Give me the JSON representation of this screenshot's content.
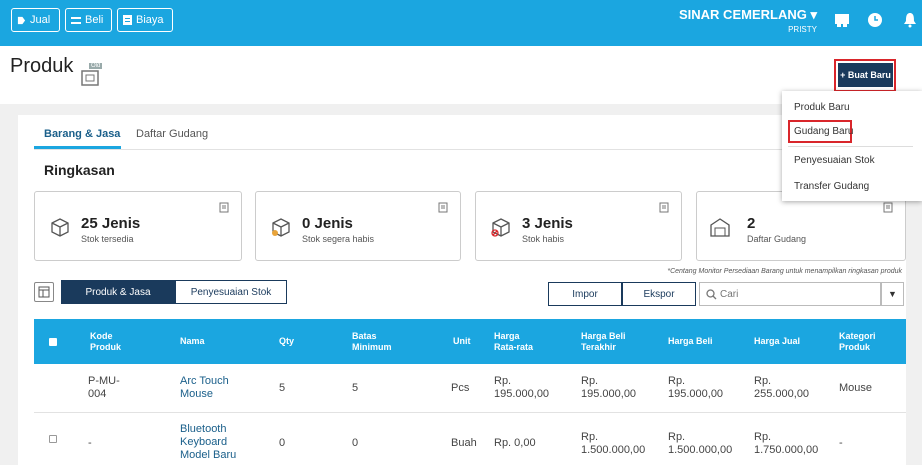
{
  "topbar": {
    "jual": "Jual",
    "beli": "Beli",
    "biaya": "Biaya",
    "company": "SINAR CEMERLANG",
    "user": "PRISTY"
  },
  "page": {
    "title": "Produk",
    "old_badge": "Old",
    "create_button": "+ Buat Baru"
  },
  "dropdown": {
    "items": [
      "Produk Baru",
      "Gudang Baru",
      "Penyesuaian Stok",
      "Transfer Gudang"
    ]
  },
  "tabs": [
    "Barang & Jasa",
    "Daftar Gudang"
  ],
  "summary": {
    "heading": "Ringkasan",
    "boxes": [
      {
        "value": "25 Jenis",
        "label": "Stok tersedia"
      },
      {
        "value": "0 Jenis",
        "label": "Stok segera habis"
      },
      {
        "value": "3 Jenis",
        "label": "Stok habis"
      },
      {
        "value": "2",
        "label": "Daftar Gudang"
      }
    ],
    "note": "*Centang Monitor Persediaan Barang untuk menampilkan ringkasan produk"
  },
  "toolbar": {
    "toggle_left": "Produk & Jasa",
    "toggle_right": "Penyesuaian Stok",
    "import": "Impor",
    "export": "Ekspor",
    "search_placeholder": "Cari"
  },
  "table": {
    "headers": [
      "Kode Produk",
      "Nama",
      "Qty",
      "Batas Minimum",
      "Unit",
      "Harga Rata-rata",
      "Harga Beli Terakhir",
      "Harga Beli",
      "Harga Jual",
      "Kategori Produk"
    ],
    "rows": [
      [
        "P-MU-004",
        "Arc Touch Mouse",
        "5",
        "5",
        "Pcs",
        "Rp. 195.000,00",
        "Rp. 195.000,00",
        "Rp. 195.000,00",
        "Rp. 255.000,00",
        "Mouse"
      ],
      [
        "-",
        "Bluetooth Keyboard Model Baru",
        "0",
        "0",
        "Buah",
        "Rp. 0,00",
        "Rp. 1.500.000,00",
        "Rp. 1.500.000,00",
        "Rp. 1.750.000,00",
        "-"
      ]
    ]
  },
  "colors": {
    "accent": "#1ba6e0",
    "navy": "#1a3a5c",
    "link": "#1a5f8a",
    "highlight": "#d9262b"
  }
}
